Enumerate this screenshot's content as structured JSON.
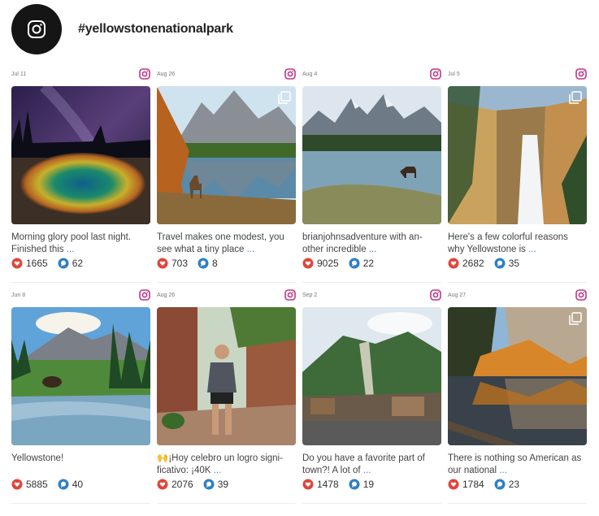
{
  "header": {
    "hashtag": "#yellowstonenationalpark",
    "avatar_icon": "instagram-icon"
  },
  "colors": {
    "like": "#e0453a",
    "comment": "#2f7fc4",
    "more_link": "#3a86c8",
    "instagram": "#c13584"
  },
  "posts": [
    {
      "date": "Jul 11",
      "caption": "Morning glory pool last night. Finished this",
      "more": "...",
      "likes": "1665",
      "comments": "62"
    },
    {
      "date": "Aug 26",
      "caption": "Travel makes one modest, you see what a tiny place",
      "more": "...",
      "likes": "703",
      "comments": "8"
    },
    {
      "date": "Aug 4",
      "caption": "brianjohnsadventure with an-other incredible",
      "more": "...",
      "likes": "9025",
      "comments": "22"
    },
    {
      "date": "Jul 5",
      "caption": "Here's a few colorful reasons why Yellowstone is",
      "more": "...",
      "likes": "2682",
      "comments": "35"
    },
    {
      "date": "Jun 8",
      "caption": "Yellowstone!",
      "more": "",
      "likes": "5885",
      "comments": "40"
    },
    {
      "date": "Aug 26",
      "caption": "🙌¡Hoy celebro un logro signi-ficativo: ¡40K",
      "more": "...",
      "likes": "2076",
      "comments": "39"
    },
    {
      "date": "Sep 2",
      "caption": "Do you have a favorite part of town?! A lot of",
      "more": "...",
      "likes": "1478",
      "comments": "19"
    },
    {
      "date": "Aug 27",
      "caption": "There is nothing so American as our national",
      "more": "...",
      "likes": "1784",
      "comments": "23"
    }
  ]
}
